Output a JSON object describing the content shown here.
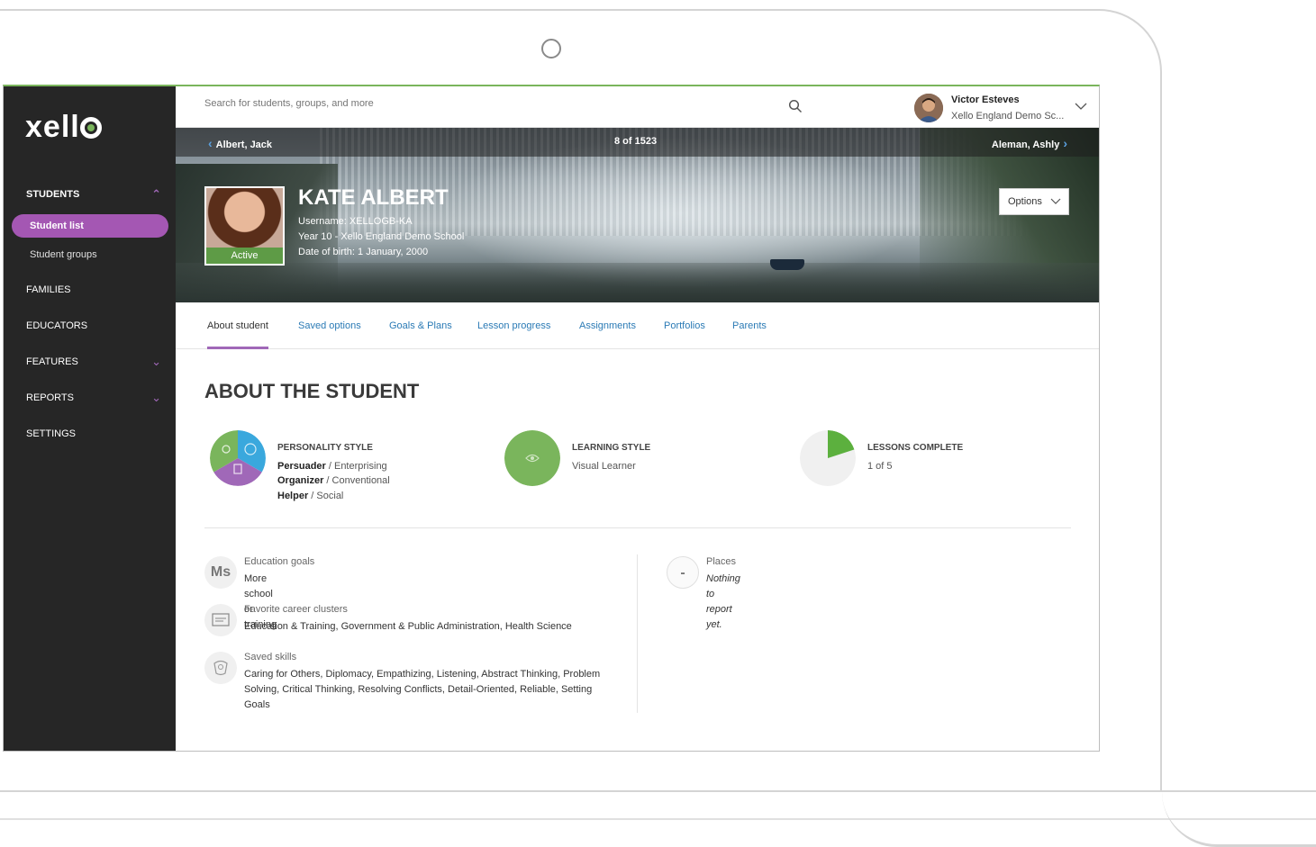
{
  "sidebar": {
    "logo": "xello",
    "items": [
      {
        "label": "STUDENTS"
      },
      {
        "label": "Student list"
      },
      {
        "label": "Student groups"
      },
      {
        "label": "FAMILIES"
      },
      {
        "label": "EDUCATORS"
      },
      {
        "label": "FEATURES"
      },
      {
        "label": "REPORTS"
      },
      {
        "label": "SETTINGS"
      }
    ]
  },
  "topbar": {
    "search_placeholder": "Search for students, groups, and more",
    "user_name": "Victor Esteves",
    "user_school": "Xello England Demo Sc..."
  },
  "banner": {
    "prev_student": "Albert, Jack",
    "counter": "8 of 1523",
    "next_student": "Aleman, Ashly",
    "student_name": "KATE ALBERT",
    "status": "Active",
    "username": "Username: XELLOGB-KA",
    "year": "Year 10 - Xello England Demo School",
    "dob": "Date of birth: 1 January, 2000",
    "options_label": "Options"
  },
  "tabs": [
    {
      "label": "About student"
    },
    {
      "label": "Saved options"
    },
    {
      "label": "Goals & Plans"
    },
    {
      "label": "Lesson progress"
    },
    {
      "label": "Assignments"
    },
    {
      "label": "Portfolios"
    },
    {
      "label": "Parents"
    }
  ],
  "about": {
    "title": "ABOUT THE STUDENT",
    "personality": {
      "title": "PERSONALITY STYLE",
      "lines": [
        {
          "bold": "Persuader",
          "rest": " / Enterprising"
        },
        {
          "bold": "Organizer",
          "rest": " / Conventional"
        },
        {
          "bold": "Helper",
          "rest": " / Social"
        }
      ]
    },
    "learning": {
      "title": "LEARNING STYLE",
      "value": "Visual Learner"
    },
    "lessons": {
      "title": "LESSONS COMPLETE",
      "value": "1 of 5",
      "completed": 1,
      "total": 5
    },
    "education_goals": {
      "icon_text": "Ms",
      "label": "Education goals",
      "value": "More school or training"
    },
    "career_clusters": {
      "label": "Favorite career clusters",
      "value": "Education & Training, Government & Public Administration, Health Science"
    },
    "saved_skills": {
      "label": "Saved skills",
      "value": "Caring for Others, Diplomacy, Empathizing, Listening, Abstract Thinking, Problem Solving, Critical Thinking, Resolving Conflicts, Detail-Oriented, Reliable, Setting Goals"
    },
    "places": {
      "icon_text": "-",
      "label": "Places",
      "value": "Nothing to report yet."
    }
  },
  "colors": {
    "sidebar_bg": "#262626",
    "accent_purple": "#a457b3",
    "accent_green": "#7ab55c",
    "link_blue": "#2a7ab5"
  }
}
